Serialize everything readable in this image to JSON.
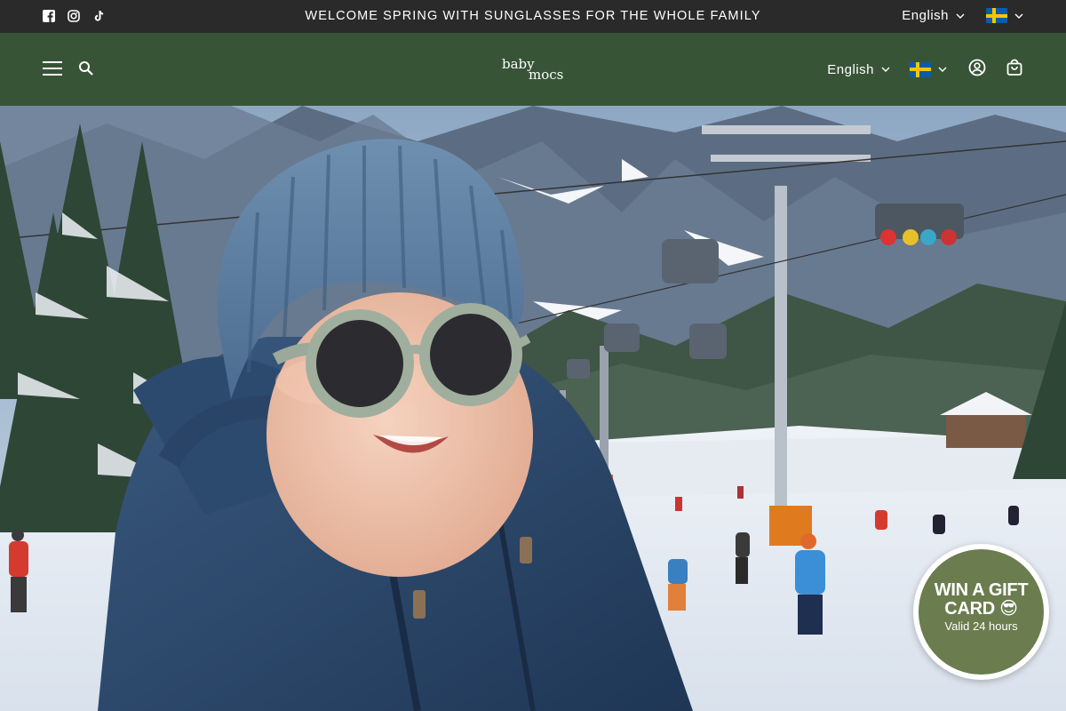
{
  "announcement": {
    "text": "WELCOME SPRING WITH SUNGLASSES FOR THE WHOLE FAMILY",
    "social": [
      "facebook-icon",
      "instagram-icon",
      "tiktok-icon"
    ],
    "language": "English",
    "country_flag": "sweden-flag"
  },
  "header": {
    "logo": "baby mocs",
    "logo_line1": "baby",
    "logo_line2": "mocs",
    "language": "English",
    "country_flag": "sweden-flag",
    "background": "#385437"
  },
  "hero": {
    "description_icons": [
      "menu-icon",
      "search-icon",
      "account-icon",
      "cart-icon"
    ]
  },
  "gift_badge": {
    "title": "WIN A GIFT CARD 😎",
    "subtitle": "Valid 24 hours",
    "color": "#6b7c4e"
  }
}
